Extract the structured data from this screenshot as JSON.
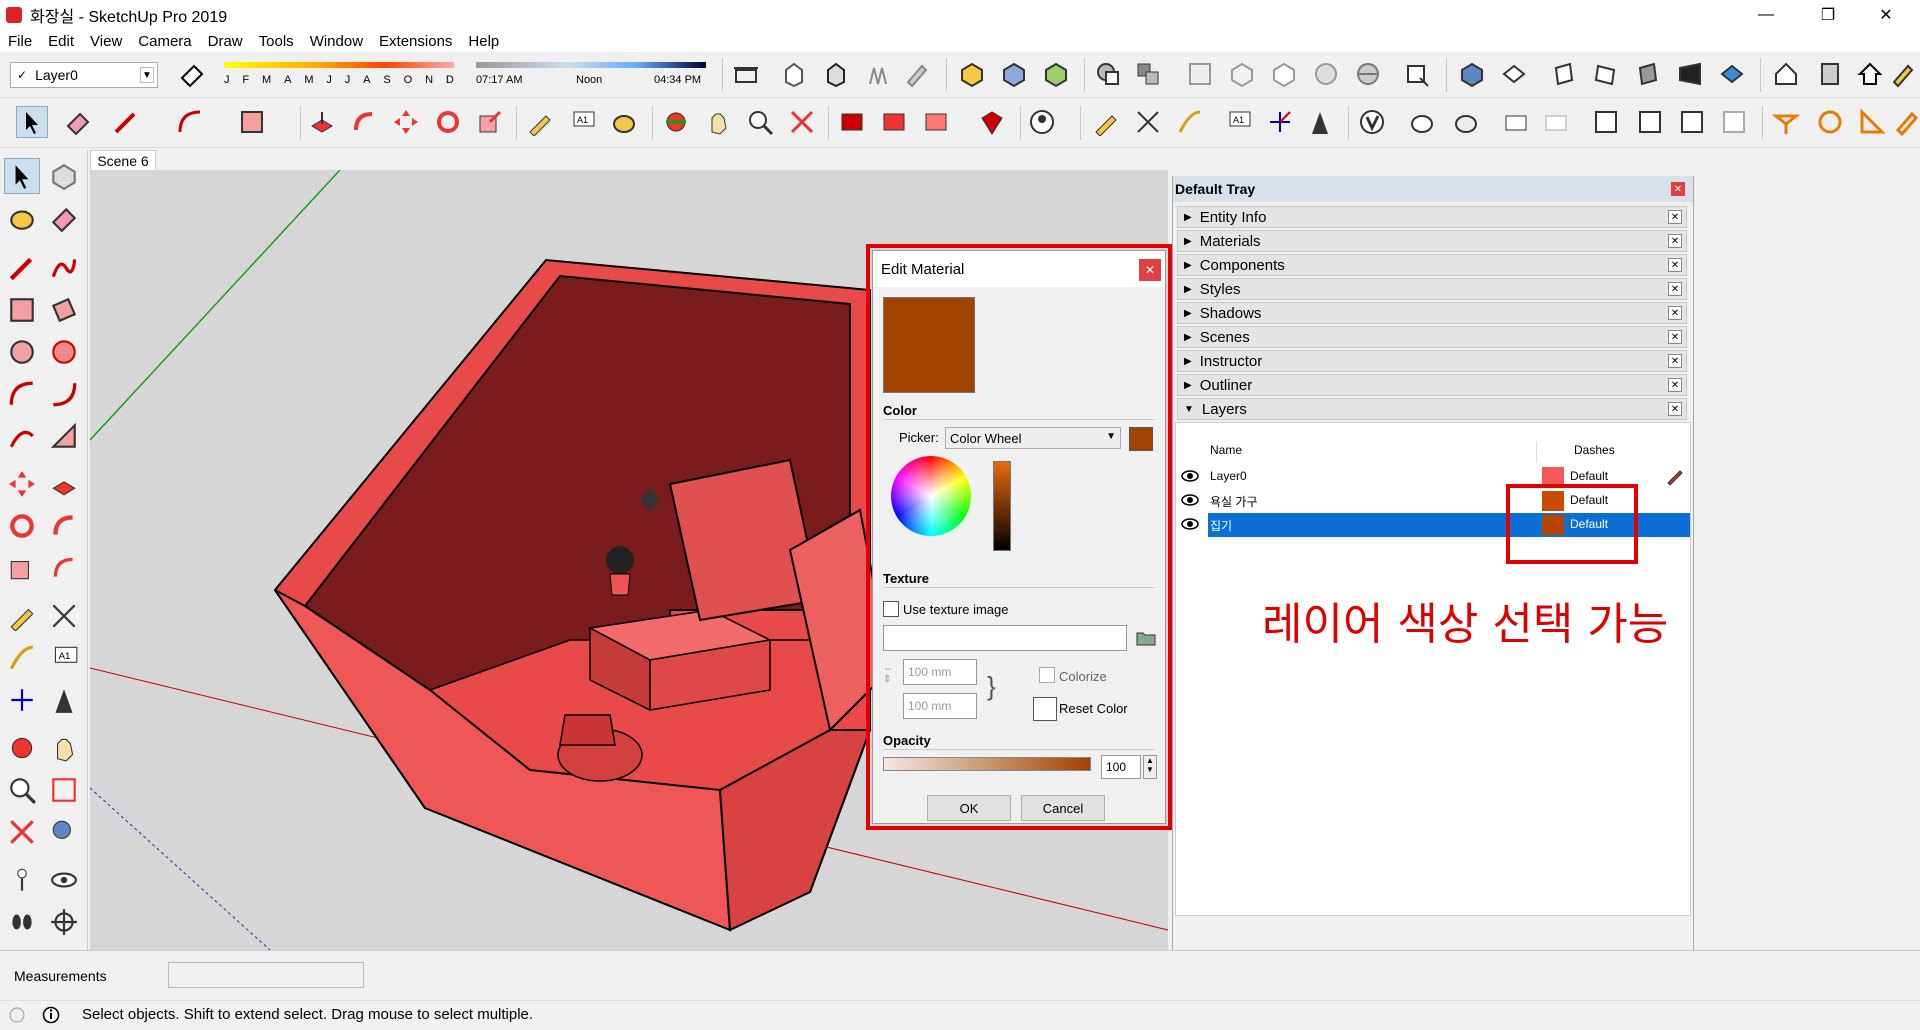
{
  "window": {
    "title": "화장실 - SketchUp Pro 2019",
    "controls": [
      "minimize",
      "restore",
      "close"
    ]
  },
  "menu": [
    "File",
    "Edit",
    "View",
    "Camera",
    "Draw",
    "Tools",
    "Window",
    "Extensions",
    "Help"
  ],
  "layer_toolbar": {
    "current_layer": "Layer0"
  },
  "shadow_settings": {
    "months": [
      "J",
      "F",
      "M",
      "A",
      "M",
      "J",
      "J",
      "A",
      "S",
      "O",
      "N",
      "D"
    ],
    "sunrise": "07:17 AM",
    "noon": "Noon",
    "sunset": "04:34 PM"
  },
  "scene_tab": "Scene 6",
  "edit_material": {
    "title": "Edit Material",
    "color_section": "Color",
    "picker_label": "Picker:",
    "picker_value": "Color Wheel",
    "texture_section": "Texture",
    "use_texture_label": "Use texture image",
    "width_value": "100 mm",
    "height_value": "100 mm",
    "colorize_label": "Colorize",
    "reset_color_label": "Reset Color",
    "opacity_section": "Opacity",
    "opacity_value": "100",
    "ok_label": "OK",
    "cancel_label": "Cancel",
    "material_color": "#a14300"
  },
  "tray": {
    "title": "Default Tray",
    "panels": [
      {
        "label": "Entity Info"
      },
      {
        "label": "Materials"
      },
      {
        "label": "Components"
      },
      {
        "label": "Styles"
      },
      {
        "label": "Shadows"
      },
      {
        "label": "Scenes"
      },
      {
        "label": "Instructor"
      },
      {
        "label": "Outliner"
      },
      {
        "label": "Layers"
      }
    ],
    "layers": {
      "col_name": "Name",
      "col_dashes": "Dashes",
      "rows": [
        {
          "name": "Layer0",
          "color": "#f25a5a",
          "dashes": "Default"
        },
        {
          "name": "욕실 가구",
          "color": "#c84b00",
          "dashes": "Default"
        },
        {
          "name": "집기",
          "color": "#b84400",
          "dashes": "Default",
          "selected": true
        }
      ]
    }
  },
  "annotation": "레이어 색상 선택 가능",
  "measurements_label": "Measurements",
  "status_text": "Select objects. Shift to extend select. Drag mouse to select multiple."
}
